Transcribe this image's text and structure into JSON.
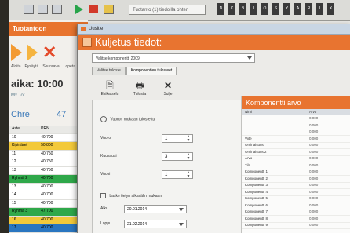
{
  "app": {
    "search_placeholder": "Tuotanto (1) tiedoilla ohten",
    "toolbar_icons": [
      "folder-icon",
      "save-icon",
      "window-icon",
      "play-icon",
      "stop-icon",
      "star-icon"
    ],
    "toolbar_group": [
      "N",
      "C",
      "B",
      "I",
      "O",
      "S",
      "Y",
      "A",
      "R",
      "I",
      "X"
    ]
  },
  "left_panel": {
    "title": "Tuotantoon",
    "operations": [
      "Aloita",
      "Pysäytä",
      "Seuraava",
      "Lopeta"
    ],
    "time_label": "aika: 10:00",
    "sub_label": "Mx   Tot",
    "chr_label": "Chre",
    "chr_value": "47",
    "rows": [
      {
        "c1": "Aste",
        "c2": "PRN",
        "c3": "",
        "bg": "#e9e9e6"
      },
      {
        "c1": "10",
        "c2": "40 700",
        "c3": "",
        "bg": "#fff"
      },
      {
        "c1": "Kipinärei",
        "c2": "50 800",
        "c3": "",
        "bg": "#f3c93a"
      },
      {
        "c1": "11",
        "c2": "40 750",
        "c3": "",
        "bg": "#fff"
      },
      {
        "c1": "12",
        "c2": "40 750",
        "c3": "",
        "bg": "#fff"
      },
      {
        "c1": "13",
        "c2": "40 750",
        "c3": "",
        "bg": "#fff"
      },
      {
        "c1": "Ryhmä 2",
        "c2": "40 700",
        "c3": "",
        "bg": "#2fa84a"
      },
      {
        "c1": "13",
        "c2": "40 700",
        "c3": "",
        "bg": "#fff"
      },
      {
        "c1": "14",
        "c2": "40 700",
        "c3": "",
        "bg": "#fff"
      },
      {
        "c1": "15",
        "c2": "40 700",
        "c3": "",
        "bg": "#fff"
      },
      {
        "c1": "Ryhmä 3",
        "c2": "47 700",
        "c3": "",
        "bg": "#2fa84a"
      },
      {
        "c1": "16",
        "c2": "40 700",
        "c3": "",
        "bg": "#f3c93a"
      },
      {
        "c1": "17",
        "c2": "40 700",
        "c3": "",
        "bg": "#2a76c0"
      },
      {
        "c1": "18",
        "c2": "40 700",
        "c3": "",
        "bg": "#fff"
      }
    ]
  },
  "dialog": {
    "window_title": "Uusitie",
    "header": "Kuljetus tiedot:",
    "select_value": "Valitse komponentti 2009",
    "tabs": [
      "Valitse tuloste",
      "Komponentien tulosteet"
    ],
    "active_tab": 1,
    "buttons": [
      {
        "label": "Esikatselu",
        "icon": "preview-icon"
      },
      {
        "label": "Tulosta",
        "icon": "printer-icon"
      },
      {
        "label": "Sulje",
        "icon": "close-icon"
      }
    ],
    "radio_label": "Vuoron mukaan tulostettu",
    "fields": [
      {
        "label": "Vuoro",
        "value": "1"
      },
      {
        "label": "Kuukausi",
        "value": "3"
      },
      {
        "label": "Vuosi",
        "value": "1"
      }
    ],
    "checkbox_label": "Laske tietyn aikavälin mukaan",
    "dates": [
      {
        "label": "Alku",
        "value": "20.01.2014"
      },
      {
        "label": "Loppu",
        "value": "21.02.2014"
      }
    ],
    "right_panel": {
      "title": "Komponentti arvo",
      "col_headers": [
        "Nimi",
        "Arvo"
      ],
      "rows": [
        {
          "name": "",
          "value": "0.000"
        },
        {
          "name": "",
          "value": "0.000"
        },
        {
          "name": "",
          "value": "0.000"
        },
        {
          "name": "Viite",
          "value": "0.000"
        },
        {
          "name": "Ominaisuus",
          "value": "0.000"
        },
        {
          "name": "Ominaisuus 2",
          "value": "0.000"
        },
        {
          "name": "Arvo",
          "value": "0.000"
        },
        {
          "name": "Tila",
          "value": "0.000"
        },
        {
          "name": "Komponentti 1",
          "value": "0.000"
        },
        {
          "name": "Komponentti 2",
          "value": "0.000"
        },
        {
          "name": "Komponentti 3",
          "value": "0.000"
        },
        {
          "name": "Komponentti 4",
          "value": "0.000"
        },
        {
          "name": "Komponentti 5",
          "value": "0.000"
        },
        {
          "name": "Komponentti 6",
          "value": "0.000"
        },
        {
          "name": "Komponentti 7",
          "value": "0.000"
        },
        {
          "name": "Komponentti 8",
          "value": "0.000"
        },
        {
          "name": "Komponentti 9",
          "value": "0.000"
        }
      ]
    }
  }
}
